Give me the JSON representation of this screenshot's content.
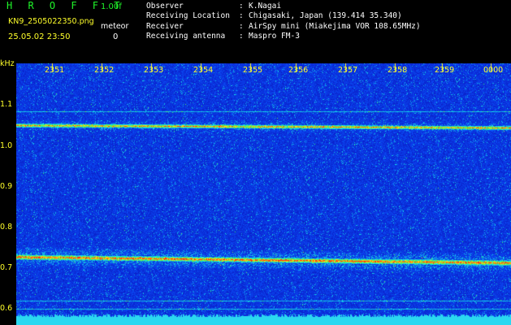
{
  "header": {
    "brand": "H R O F F T",
    "version": "1.00f",
    "filename": "KN9_2505022350.png",
    "timestamp": "25.05.02 23:50",
    "meteor_label": "meteor",
    "meteor_count": "0",
    "info": [
      {
        "key": "Observer",
        "value": "K.Nagai"
      },
      {
        "key": "Receiving Location",
        "value": "Chigasaki, Japan (139.414 35.340)"
      },
      {
        "key": "Receiver",
        "value": "AirSpy mini (Miakejima VOR 108.65MHz)"
      },
      {
        "key": "Receiving antenna",
        "value": "Maspro FM-3"
      }
    ]
  },
  "axis": {
    "unit": "kHz",
    "y_ticks": [
      "1.1",
      "1.0",
      "0.9",
      "0.8",
      "0.7",
      "0.6"
    ],
    "x_ticks": [
      "2351",
      "2352",
      "2353",
      "2354",
      "2355",
      "2356",
      "2357",
      "2358",
      "2359",
      "0000"
    ]
  },
  "colors": {
    "brand": "#1ff52a",
    "label": "#ffff2a",
    "background": "#0a1fd0",
    "signal": "#ff2a10"
  }
}
